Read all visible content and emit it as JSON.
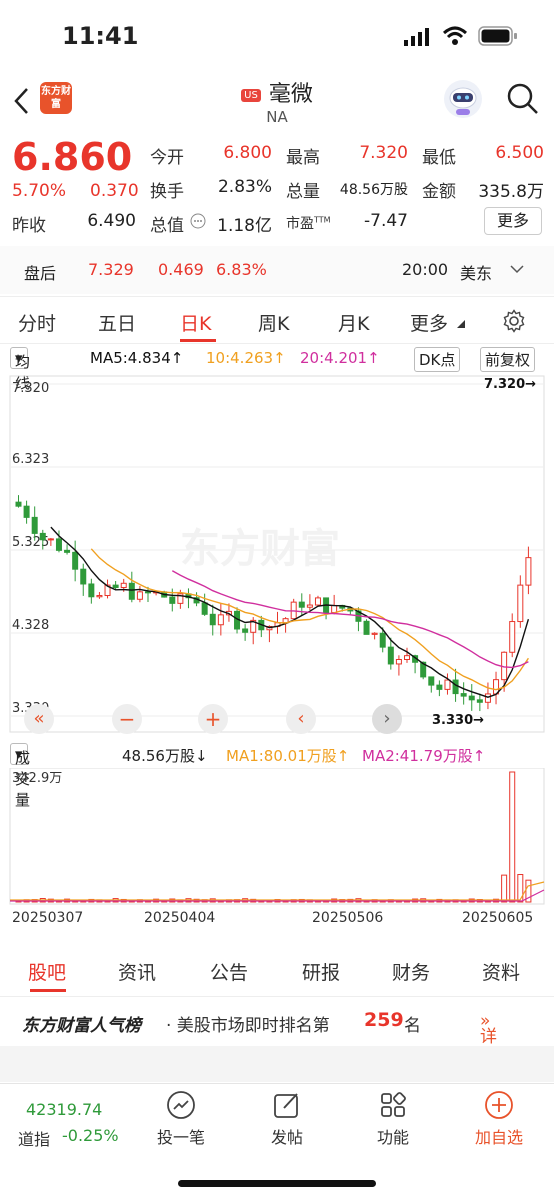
{
  "status": {
    "time": "11:41"
  },
  "header": {
    "logo_text": "东方财富",
    "market_tag": "US",
    "title": "毫微",
    "subtitle": "NA"
  },
  "quote": {
    "price": "6.860",
    "change_pct": "5.70%",
    "change_abs": "0.370",
    "prev_close_label": "昨收",
    "prev_close": "6.490",
    "open_label": "今开",
    "open": "6.800",
    "high_label": "最高",
    "high": "7.320",
    "low_label": "最低",
    "low": "6.500",
    "turnover_label": "换手",
    "turnover": "2.83%",
    "volume_label": "总量",
    "volume": "48.56万股",
    "amount_label": "金额",
    "amount": "335.8万",
    "mktcap_label": "总值",
    "mktcap": "1.18亿",
    "pe_label": "市盈",
    "pe_sup": "TTM",
    "pe": "-7.47",
    "more_label": "更多"
  },
  "after_hours": {
    "label": "盘后",
    "price": "7.329",
    "change": "0.469",
    "pct": "6.83%",
    "time": "20:00",
    "zone": "美东"
  },
  "period_tabs": [
    "分时",
    "五日",
    "日K",
    "周K",
    "月K",
    "更多"
  ],
  "active_period": "日K",
  "ma_bar": {
    "type": "均线",
    "ma5": "MA5:4.834↑",
    "ma10": "10:4.263↑",
    "ma20": "20:4.201↑",
    "dk": "DK点",
    "adjust": "前复权"
  },
  "vol_bar": {
    "type": "成交量",
    "vol": "48.56万股↓",
    "ma1": "MA1:80.01万股↑",
    "ma2": "MA2:41.79万股↑",
    "max": "342.9万"
  },
  "chart_data": {
    "type": "candlestick",
    "y_ticks": [
      "7.320",
      "6.323",
      "5.325",
      "4.328",
      "3.330"
    ],
    "ylim": [
      3.33,
      7.32
    ],
    "x_ticks": [
      "20250307",
      "20250404",
      "20250506",
      "20250605"
    ],
    "annotations": {
      "max_label": "7.320→",
      "min_label": "3.330→"
    },
    "watermark": "东方财富",
    "colors": {
      "up": "#e8352b",
      "down": "#2f9a3a",
      "ma5": "#111111",
      "ma10": "#f0a020",
      "ma20": "#d02f9e"
    }
  },
  "info_tabs": [
    "股吧",
    "资讯",
    "公告",
    "研报",
    "财务",
    "资料"
  ],
  "active_info": "股吧",
  "rank": {
    "brand": "东方财富人气榜",
    "text": "· 美股市场即时排名第",
    "num": "259",
    "suffix": "名",
    "detail": "详情"
  },
  "bottom_bar": {
    "index_value": "42319.74",
    "index_name": "道指",
    "index_change": "-0.25%",
    "items": [
      {
        "label": "投一笔",
        "icon": "trend-icon"
      },
      {
        "label": "发帖",
        "icon": "edit-icon"
      },
      {
        "label": "功能",
        "icon": "grid-icon"
      },
      {
        "label": "加自选",
        "icon": "plus-circle-icon"
      }
    ]
  }
}
